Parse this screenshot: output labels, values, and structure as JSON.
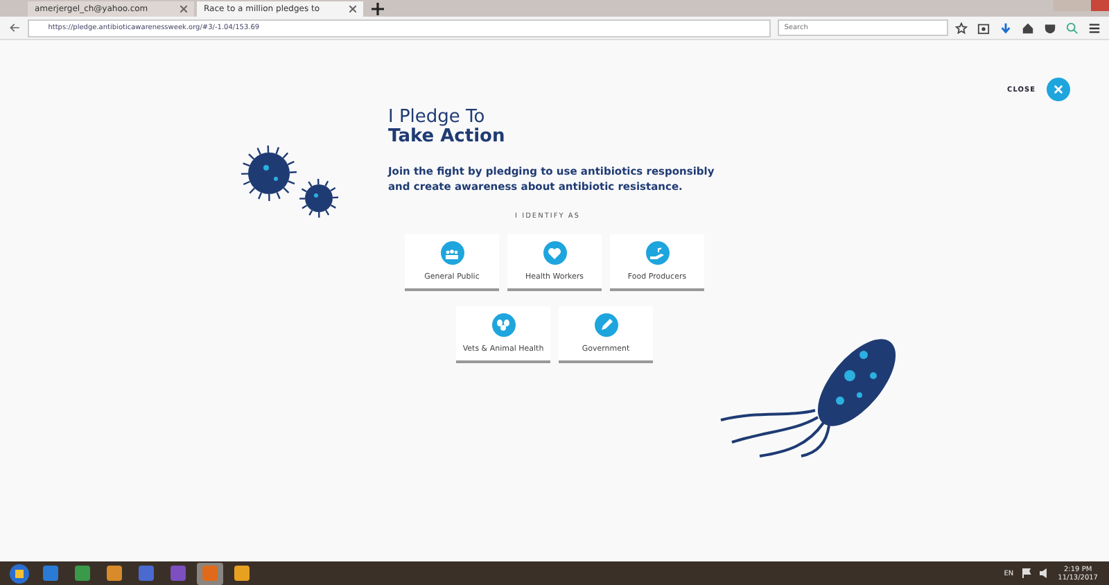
{
  "browser": {
    "tabs": [
      {
        "title": "amerjergel_ch@yahoo.com",
        "selected": false
      },
      {
        "title": "Race to a million pledges to",
        "selected": true
      }
    ],
    "url": "https://pledge.antibioticawarenessweek.org/#3/-1.04/153.69",
    "search": {
      "placeholder": "Search"
    }
  },
  "page": {
    "close": "CLOSE",
    "heading_line1": "I Pledge To",
    "heading_line2": "Take Action",
    "intro": "Join the fight by pledging to use antibiotics responsibly and create awareness about antibiotic resistance.",
    "identify_label": "I IDENTIFY AS",
    "options": [
      {
        "label": "General Public",
        "kind": "people"
      },
      {
        "label": "Health Workers",
        "kind": "heart"
      },
      {
        "label": "Food Producers",
        "kind": "hand"
      },
      {
        "label": "Vets & Animal Health",
        "kind": "paw"
      },
      {
        "label": "Government",
        "kind": "pen"
      }
    ]
  },
  "taskbar": {
    "apps": [
      {
        "selected": false
      },
      {
        "selected": false
      },
      {
        "selected": false
      },
      {
        "selected": false
      },
      {
        "selected": false
      },
      {
        "selected": false
      },
      {
        "selected": true
      },
      {
        "selected": false
      }
    ],
    "language": "EN",
    "time": "2:19 PM",
    "date": "11/13/2017"
  }
}
